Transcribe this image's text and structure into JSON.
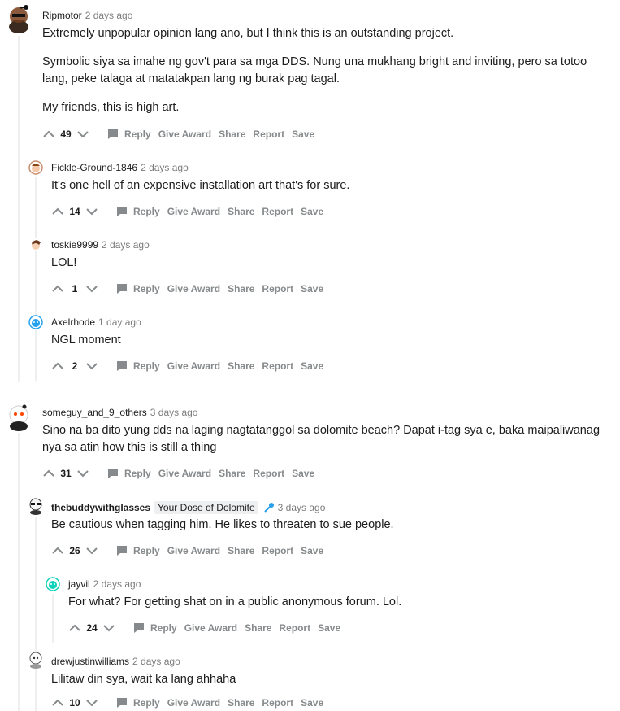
{
  "actions": {
    "reply": "Reply",
    "award": "Give Award",
    "share": "Share",
    "report": "Report",
    "save": "Save"
  },
  "comments": [
    {
      "author": "Ripmotor",
      "time": "2 days ago",
      "paragraphs": [
        "Extremely unpopular opinion lang ano, but I think this is an outstanding project.",
        "Symbolic siya sa imahe ng gov't para sa mga DDS. Nung una mukhang bright and inviting, pero sa totoo lang, peke talaga at matatakpan lang ng burak pag tagal.",
        "My friends, this is high art."
      ],
      "score": "49"
    },
    {
      "author": "Fickle-Ground-1846",
      "time": "2 days ago",
      "paragraphs": [
        "It's one hell of an expensive installation art that's for sure."
      ],
      "score": "14"
    },
    {
      "author": "toskie9999",
      "time": "2 days ago",
      "paragraphs": [
        "LOL!"
      ],
      "score": "1"
    },
    {
      "author": "Axelrhode",
      "time": "1 day ago",
      "paragraphs": [
        "NGL moment"
      ],
      "score": "2"
    },
    {
      "author": "someguy_and_9_others",
      "time": "3 days ago",
      "paragraphs": [
        "Sino na ba dito yung dds na laging nagtatanggol sa dolomite beach? Dapat i-tag sya e, baka maipaliwanag nya sa atin how this is still a thing"
      ],
      "score": "31"
    },
    {
      "author": "thebuddywithglasses",
      "flair": "Your Dose of Dolomite",
      "time": "3 days ago",
      "paragraphs": [
        "Be cautious when tagging him. He likes to threaten to sue people."
      ],
      "score": "26"
    },
    {
      "author": "jayvil",
      "time": "2 days ago",
      "paragraphs": [
        "For what? For getting shat on in a public anonymous forum. Lol."
      ],
      "score": "24"
    },
    {
      "author": "drewjustinwilliams",
      "time": "2 days ago",
      "paragraphs": [
        "Lilitaw din sya, wait ka lang ahhaha"
      ],
      "score": "10"
    }
  ]
}
